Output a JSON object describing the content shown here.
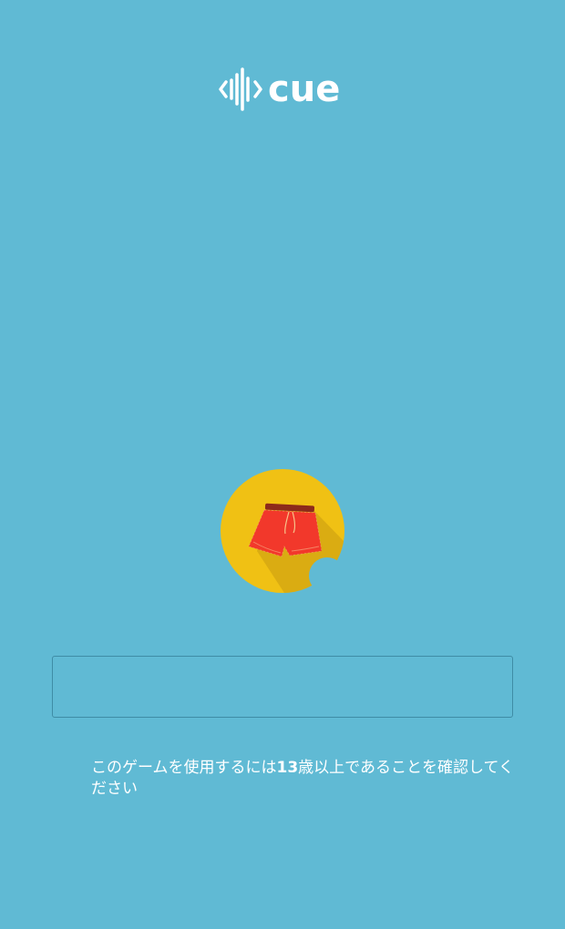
{
  "brand": {
    "logo_text": "cue",
    "logo_icon": "sound-wave-brackets-icon"
  },
  "avatar": {
    "icon": "red-shorts-icon",
    "circle_color": "#f0c114",
    "item_color": "#f2382b"
  },
  "name_input": {
    "value": "",
    "placeholder": ""
  },
  "consent": {
    "text_before": "このゲームを使用するには",
    "age": "13",
    "text_after": "歳以上であることを確認してください"
  },
  "colors": {
    "background": "#60bad4",
    "text": "#ffffff",
    "input_border": "#3f8ca5"
  }
}
